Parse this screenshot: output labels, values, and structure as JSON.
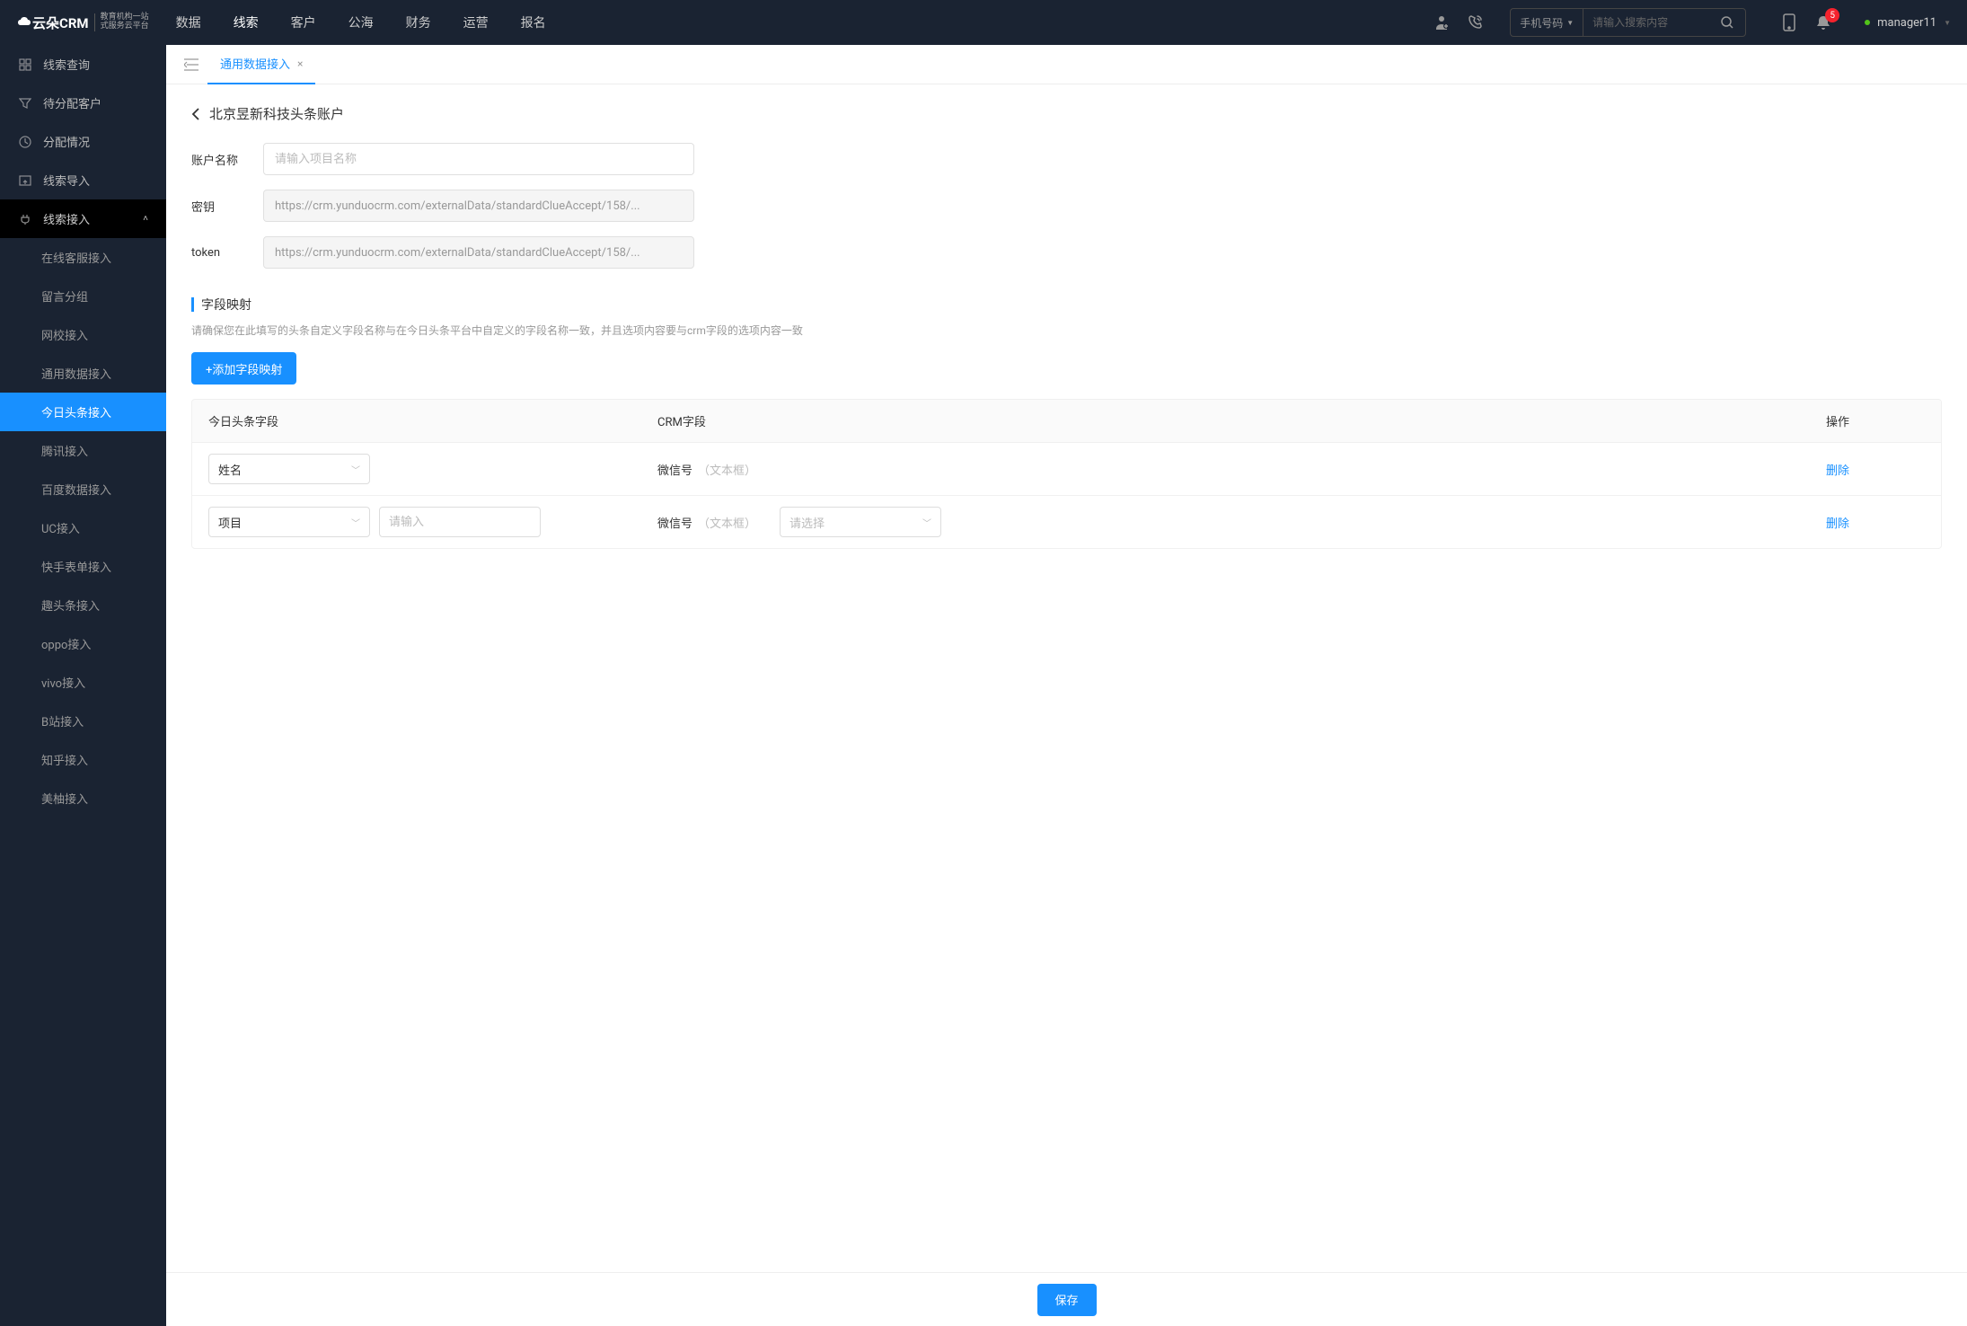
{
  "header": {
    "logo_main": "云朵CRM",
    "logo_sub1": "教育机构一站",
    "logo_sub2": "式服务云平台",
    "nav": [
      "数据",
      "线索",
      "客户",
      "公海",
      "财务",
      "运营",
      "报名"
    ],
    "nav_active": 1,
    "search_type": "手机号码",
    "search_placeholder": "请输入搜索内容",
    "notif_count": "5",
    "user": "manager11"
  },
  "sidebar": {
    "items": [
      {
        "label": "线索查询",
        "icon": "grid"
      },
      {
        "label": "待分配客户",
        "icon": "filter"
      },
      {
        "label": "分配情况",
        "icon": "clock"
      },
      {
        "label": "线索导入",
        "icon": "upload"
      },
      {
        "label": "线索接入",
        "icon": "plug",
        "expanded": true,
        "children": [
          {
            "label": "在线客服接入"
          },
          {
            "label": "留言分组"
          },
          {
            "label": "网校接入"
          },
          {
            "label": "通用数据接入"
          },
          {
            "label": "今日头条接入",
            "active": true
          },
          {
            "label": "腾讯接入"
          },
          {
            "label": "百度数据接入"
          },
          {
            "label": "UC接入"
          },
          {
            "label": "快手表单接入"
          },
          {
            "label": "趣头条接入"
          },
          {
            "label": "oppo接入"
          },
          {
            "label": "vivo接入"
          },
          {
            "label": "B站接入"
          },
          {
            "label": "知乎接入"
          },
          {
            "label": "美柚接入"
          }
        ]
      }
    ]
  },
  "tabs": {
    "items": [
      {
        "label": "通用数据接入"
      }
    ]
  },
  "page": {
    "title": "北京昱新科技头条账户",
    "form": {
      "account_label": "账户名称",
      "account_placeholder": "请输入项目名称",
      "key_label": "密钥",
      "key_value": "https://crm.yunduocrm.com/externalData/standardClueAccept/158/...",
      "token_label": "token",
      "token_value": "https://crm.yunduocrm.com/externalData/standardClueAccept/158/..."
    },
    "section": {
      "title": "字段映射",
      "desc": "请确保您在此填写的头条自定义字段名称与在今日头条平台中自定义的字段名称一致，并且选项内容要与crm字段的选项内容一致",
      "add_btn": "+添加字段映射"
    },
    "table": {
      "headers": [
        "今日头条字段",
        "CRM字段",
        "操作"
      ],
      "rows": [
        {
          "field": "姓名",
          "has_input": false,
          "crm_field": "微信号",
          "crm_hint": "（文本框）",
          "has_crm_select": false,
          "action": "删除"
        },
        {
          "field": "项目",
          "has_input": true,
          "input_placeholder": "请输入",
          "crm_field": "微信号",
          "crm_hint": "（文本框）",
          "has_crm_select": true,
          "crm_select_placeholder": "请选择",
          "action": "删除"
        }
      ]
    },
    "save_btn": "保存"
  }
}
